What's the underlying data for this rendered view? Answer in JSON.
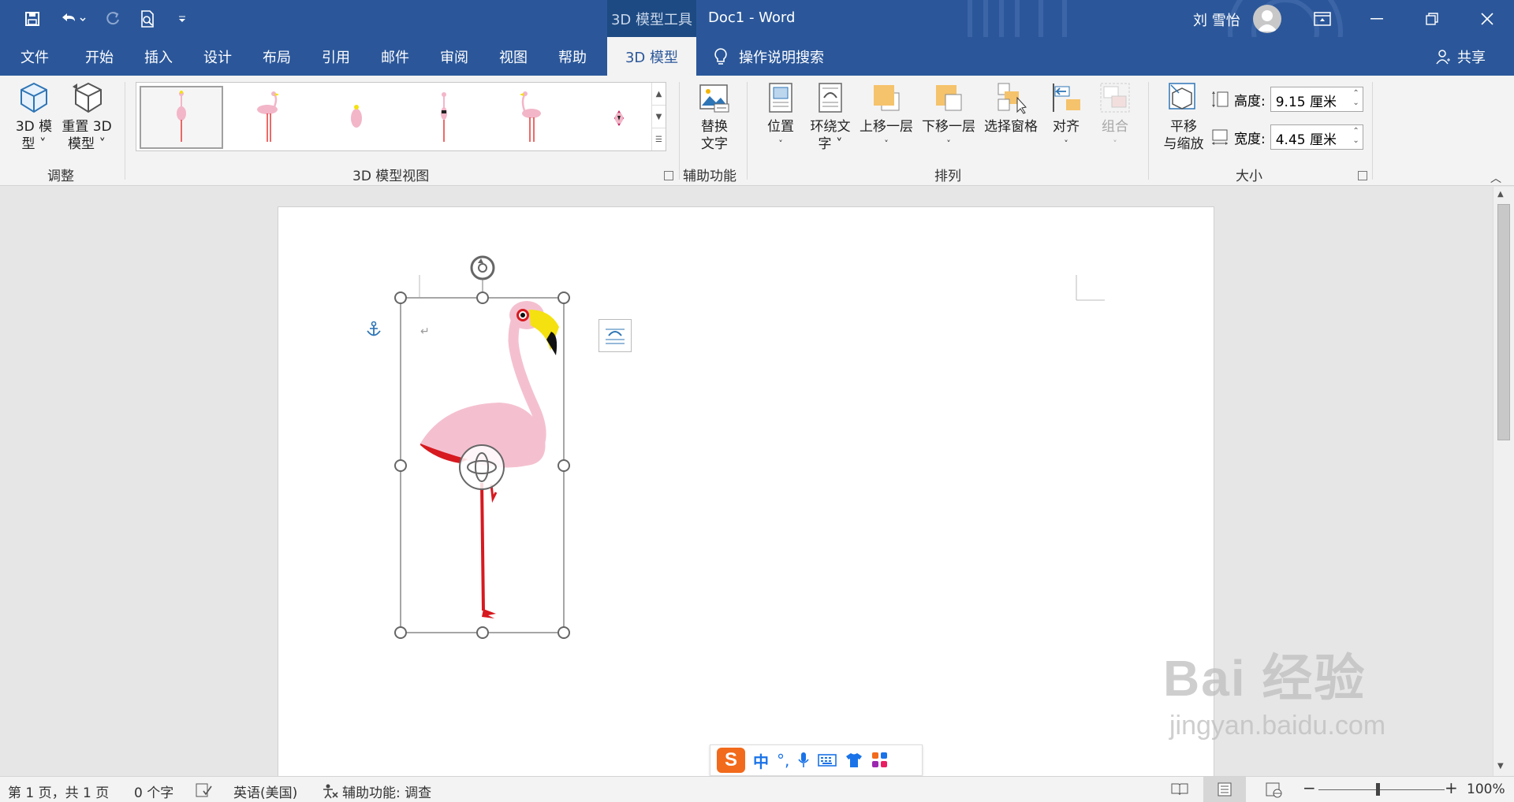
{
  "titlebar": {
    "context_tab_group": "3D 模型工具",
    "doc_title": "Doc1  -  Word",
    "user_name": "刘 雪怡"
  },
  "tabs": [
    {
      "label": "文件"
    },
    {
      "label": "开始"
    },
    {
      "label": "插入"
    },
    {
      "label": "设计"
    },
    {
      "label": "布局"
    },
    {
      "label": "引用"
    },
    {
      "label": "邮件"
    },
    {
      "label": "审阅"
    },
    {
      "label": "视图"
    },
    {
      "label": "帮助"
    },
    {
      "label": "3D 模型",
      "active": true
    }
  ],
  "tell_me": "操作说明搜索",
  "share": "共享",
  "ribbon": {
    "adjust": {
      "btn_3d_model_l1": "3D 模",
      "btn_3d_model_l2": "型 ˅",
      "btn_reset_l1": "重置 3D",
      "btn_reset_l2": "模型 ˅",
      "label": "调整"
    },
    "views": {
      "label": "3D 模型视图"
    },
    "accessibility": {
      "alt_text_l1": "替换",
      "alt_text_l2": "文字",
      "label": "辅助功能"
    },
    "arrange": {
      "position": "位置",
      "wrap_l1": "环绕文",
      "wrap_l2": "字 ˅",
      "bring_forward": "上移一层",
      "send_backward": "下移一层",
      "selection_pane": "选择窗格",
      "align": "对齐",
      "group": "组合",
      "label": "排列"
    },
    "size": {
      "pan_zoom_l1": "平移",
      "pan_zoom_l2": "与缩放",
      "height_label": "高度:",
      "height_value": "9.15 厘米",
      "width_label": "宽度:",
      "width_value": "4.45 厘米",
      "label": "大小"
    }
  },
  "statusbar": {
    "page": "第 1 页，共 1 页",
    "words": "0 个字",
    "language": "英语(美国)",
    "accessibility": "辅助功能: 调查",
    "zoom": "100%"
  },
  "ime": {
    "mode": "中"
  },
  "watermark": {
    "brand": "Bai  经验",
    "url": "jingyan.baidu.com"
  },
  "colors": {
    "accent": "#2b579a",
    "ribbon_bg": "#f3f3f3",
    "flamingo_pink": "#f2b6c8",
    "beak_yellow": "#f4e10f"
  }
}
